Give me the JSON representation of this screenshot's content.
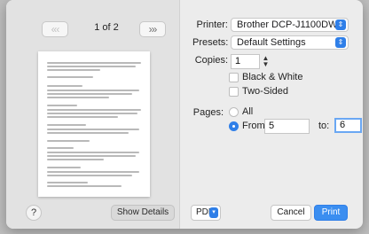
{
  "preview": {
    "page_count_text": "1 of 2",
    "prev_label": "«‹",
    "next_label": "›»"
  },
  "printer": {
    "label": "Printer:",
    "value": "Brother DCP-J1100DW",
    "chevron_icon": "up-down-chevron-icon"
  },
  "presets": {
    "label": "Presets:",
    "value": "Default Settings",
    "chevron_icon": "up-down-chevron-icon"
  },
  "copies": {
    "label": "Copies:",
    "value": "1",
    "stepper_icon": "stepper-icon"
  },
  "options": {
    "black_white_label": "Black & White",
    "black_white_checked": false,
    "two_sided_label": "Two-Sided",
    "two_sided_checked": false
  },
  "pages": {
    "label": "Pages:",
    "all_label": "All",
    "from_label": "From:",
    "from_value": "5",
    "to_label": "to:",
    "to_value": "6",
    "selected": "from"
  },
  "footer": {
    "help_label": "?",
    "show_details_label": "Show Details",
    "pdf_label": "PDF",
    "cancel_label": "Cancel",
    "print_label": "Print"
  },
  "colors": {
    "accent": "#2f7fe8",
    "focus_ring": "#6aa7f3",
    "dialog_bg": "#ececec"
  }
}
